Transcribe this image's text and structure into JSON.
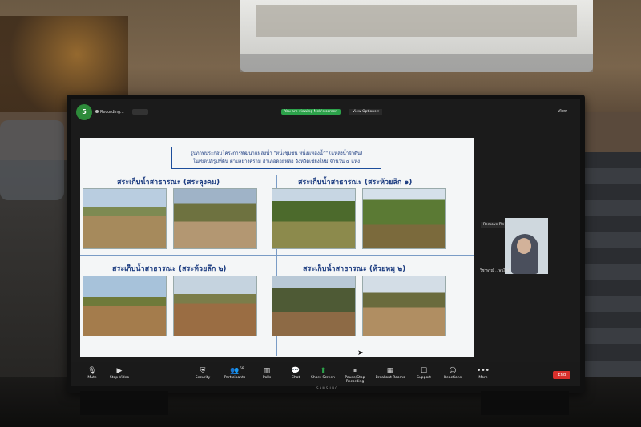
{
  "zoom": {
    "participant_initial": "5",
    "recording_label": "Recording...",
    "viewing_banner": "You are viewing Meh's screen",
    "view_options": "View Options ▾",
    "view_button": "View",
    "remove_pin": "Remove Pin",
    "pip_name": "วิชาพรณ์ ...พนไซต์",
    "end_label": "End",
    "brand": "SAMSUNG"
  },
  "slide": {
    "title_line1": "รูปภาพประกอบโครงการพัฒนาแหล่งน้ำ \"หนึ่งชุมชน หนึ่งแหล่งน้ำ\" (แหล่งน้ำผิวดิน)",
    "title_line2": "ในเขตปฏิรูปที่ดิน ตำบลยางคราม อำเภอดอยหล่อ จังหวัดเชียงใหม่ จำนวน ๔ แห่ง",
    "captions": [
      "สระเก็บน้ำสาธารณะ (สระลุงคม)",
      "สระเก็บน้ำสาธารณะ (สระห้วยลึก ๑)",
      "สระเก็บน้ำสาธารณะ (สระห้วยลึก ๒)",
      "สระเก็บน้ำสาธารณะ (ห้วยหมู ๒)"
    ]
  },
  "toolbar": [
    {
      "label": "Mute",
      "icon": "mic-icon",
      "glyph": "🎙"
    },
    {
      "label": "Stop Video",
      "icon": "video-icon",
      "glyph": "▶"
    },
    {
      "label": "Security",
      "icon": "shield-icon",
      "glyph": "⛨"
    },
    {
      "label": "Participants",
      "icon": "participants-icon",
      "glyph": "👥"
    },
    {
      "label": "Polls",
      "icon": "polls-icon",
      "glyph": "▥"
    },
    {
      "label": "Chat",
      "icon": "chat-icon",
      "glyph": "💬"
    },
    {
      "label": "Share Screen",
      "icon": "share-screen-icon",
      "glyph": "⬆"
    },
    {
      "label": "Pause/Stop Recording",
      "icon": "recording-icon",
      "glyph": "⏸"
    },
    {
      "label": "Breakout Rooms",
      "icon": "breakout-icon",
      "glyph": "▦"
    },
    {
      "label": "Support",
      "icon": "support-icon",
      "glyph": "☐"
    },
    {
      "label": "Reactions",
      "icon": "reactions-icon",
      "glyph": "☺"
    },
    {
      "label": "More",
      "icon": "more-icon",
      "glyph": "•••"
    }
  ],
  "participants_count": "58",
  "colors": {
    "accent_green": "#2ca24a",
    "end_red": "#d9302c",
    "slide_blue": "#1c4d9b"
  }
}
